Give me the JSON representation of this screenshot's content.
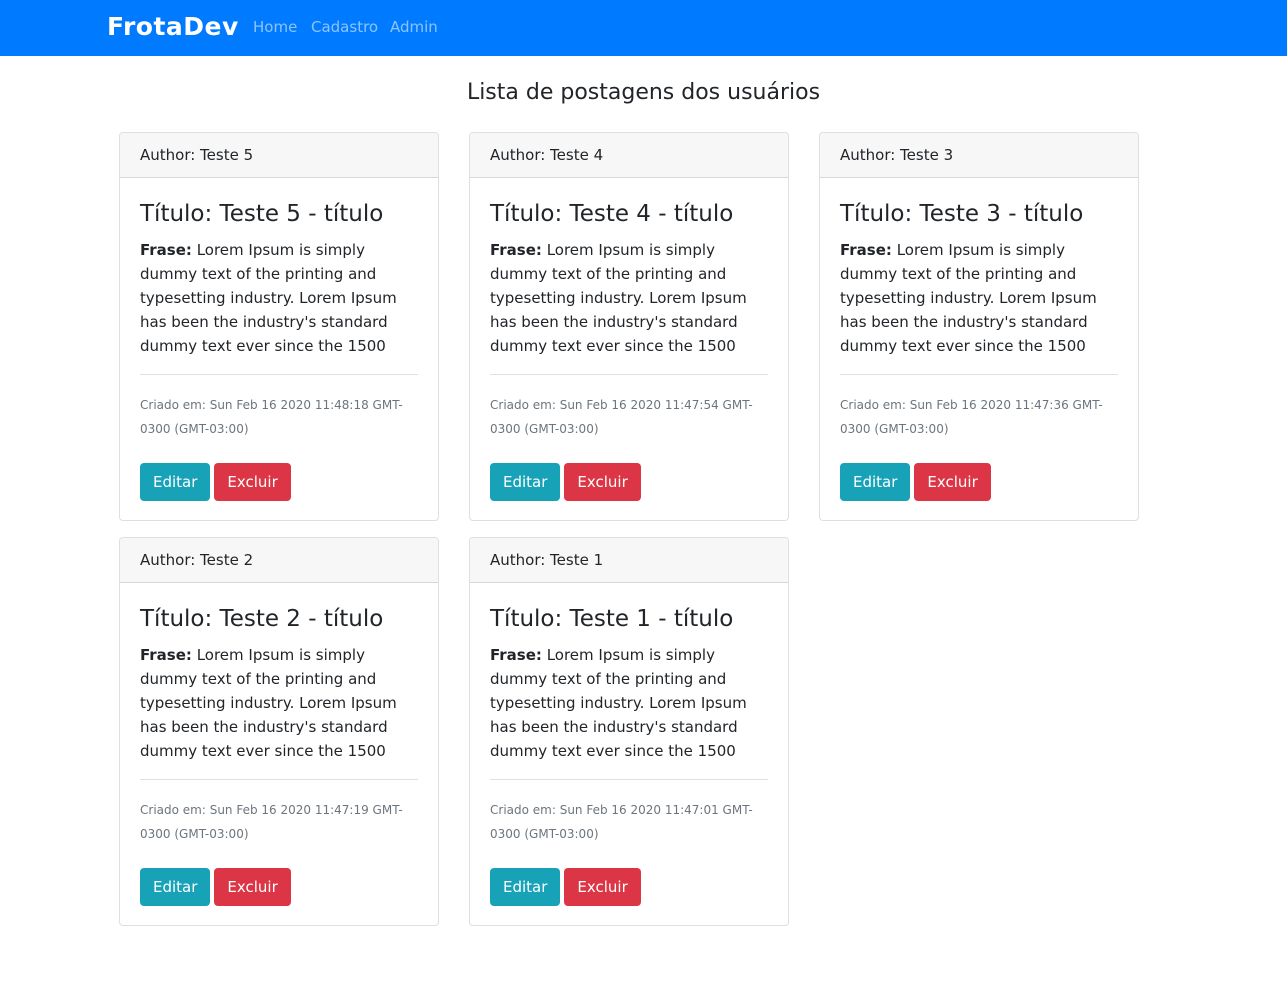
{
  "navbar": {
    "brand": "FrotaDev",
    "links": [
      "Home",
      "Cadastro",
      "Admin"
    ]
  },
  "page": {
    "title": "Lista de postagens dos usuários"
  },
  "labels": {
    "frase": "Frase:",
    "edit": "Editar",
    "delete": "Excluir"
  },
  "posts": [
    {
      "author": "Author: Teste 5",
      "title": "Título: Teste 5 - título",
      "frase": " Lorem Ipsum is simply dummy text of the printing and typesetting industry. Lorem Ipsum has been the industry's standard dummy text ever since the 1500",
      "created": "Criado em: Sun Feb 16 2020 11:48:18 GMT-0300 (GMT-03:00)"
    },
    {
      "author": "Author: Teste 4",
      "title": "Título: Teste 4 - título",
      "frase": " Lorem Ipsum is simply dummy text of the printing and typesetting industry. Lorem Ipsum has been the industry's standard dummy text ever since the 1500",
      "created": "Criado em: Sun Feb 16 2020 11:47:54 GMT-0300 (GMT-03:00)"
    },
    {
      "author": "Author: Teste 3",
      "title": "Título: Teste 3 - título",
      "frase": " Lorem Ipsum is simply dummy text of the printing and typesetting industry. Lorem Ipsum has been the industry's standard dummy text ever since the 1500",
      "created": "Criado em: Sun Feb 16 2020 11:47:36 GMT-0300 (GMT-03:00)"
    },
    {
      "author": "Author: Teste 2",
      "title": "Título: Teste 2 - título",
      "frase": " Lorem Ipsum is simply dummy text of the printing and typesetting industry. Lorem Ipsum has been the industry's standard dummy text ever since the 1500",
      "created": "Criado em: Sun Feb 16 2020 11:47:19 GMT-0300 (GMT-03:00)"
    },
    {
      "author": "Author: Teste 1",
      "title": "Título: Teste 1 - título",
      "frase": " Lorem Ipsum is simply dummy text of the printing and typesetting industry. Lorem Ipsum has been the industry's standard dummy text ever since the 1500",
      "created": "Criado em: Sun Feb 16 2020 11:47:01 GMT-0300 (GMT-03:00)"
    }
  ]
}
